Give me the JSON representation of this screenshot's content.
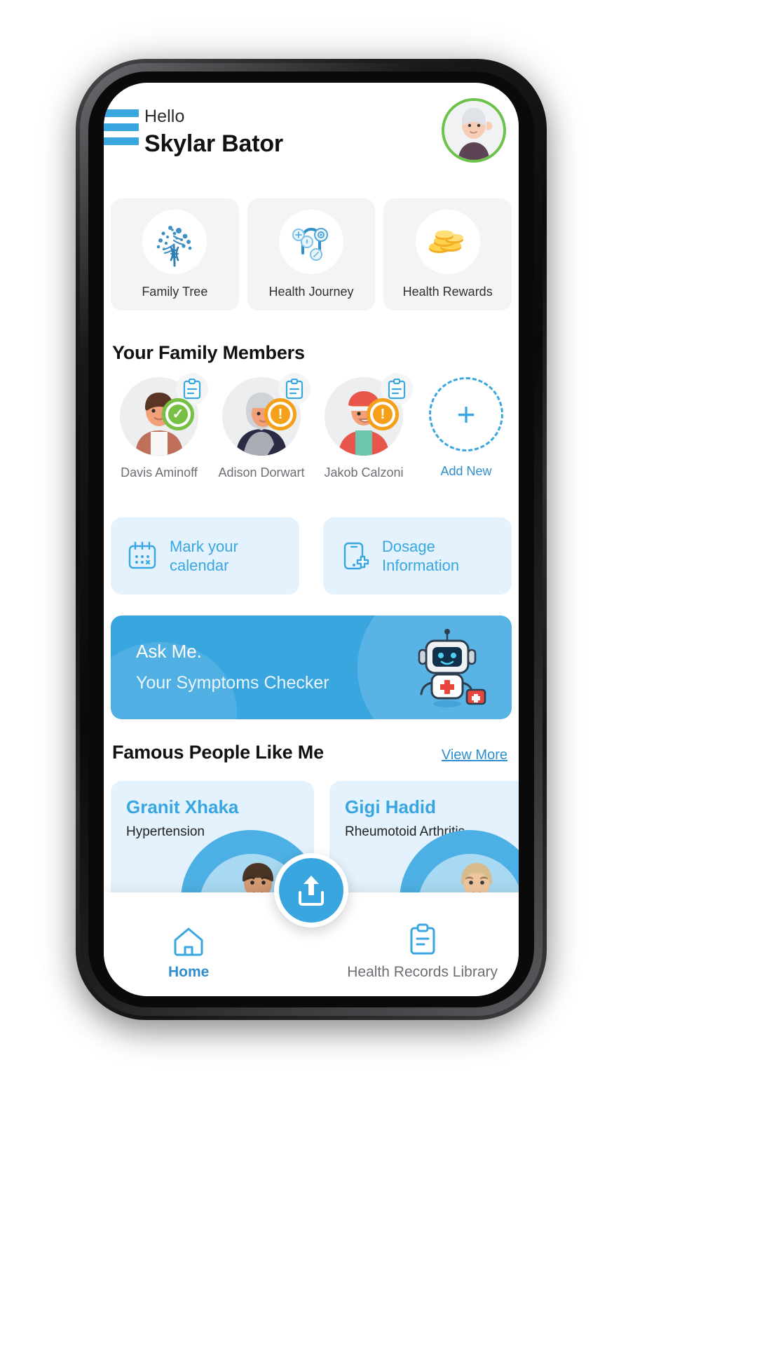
{
  "header": {
    "greeting": "Hello",
    "user_name": "Skylar Bator",
    "menu_icon": "hamburger-menu-icon",
    "avatar_icon": "user-avatar"
  },
  "quick_actions": [
    {
      "label": "Family Tree",
      "icon": "dna-tree-icon"
    },
    {
      "label": "Health Journey",
      "icon": "health-journey-path-icon"
    },
    {
      "label": "Health Rewards",
      "icon": "gold-coins-icon"
    }
  ],
  "family": {
    "section_title": "Your Family Members",
    "members": [
      {
        "name": "Davis Aminoff",
        "status": "ok",
        "status_icon": "check-badge-icon",
        "record_icon": "clipboard-icon"
      },
      {
        "name": "Adison Dorwart",
        "status": "warn",
        "status_icon": "warning-badge-icon",
        "record_icon": "clipboard-icon"
      },
      {
        "name": "Jakob Calzoni",
        "status": "warn",
        "status_icon": "warning-badge-icon",
        "record_icon": "clipboard-icon"
      }
    ],
    "add_new_label": "Add New",
    "add_new_icon": "plus-icon"
  },
  "actions": [
    {
      "line1": "Mark your",
      "line2": "calendar",
      "icon": "calendar-icon"
    },
    {
      "line1": "Dosage",
      "line2": "Information",
      "icon": "phone-pill-icon"
    }
  ],
  "banner": {
    "title": "Ask Me.",
    "subtitle": "Your Symptoms Checker",
    "icon": "robot-assistant-icon"
  },
  "famous": {
    "section_title": "Famous People Like Me",
    "view_more": "View More",
    "people": [
      {
        "name": "Granit Xhaka",
        "condition": "Hypertension"
      },
      {
        "name": "Gigi Hadid",
        "condition": "Rheumotoid Arthritis"
      }
    ]
  },
  "bottom_nav": {
    "items": [
      {
        "label": "Home",
        "icon": "home-icon",
        "active": true
      },
      {
        "label": "Health Records Library",
        "icon": "clipboard-icon",
        "active": false
      }
    ],
    "fab_icon": "upload-icon"
  },
  "colors": {
    "accent": "#3aa6e0",
    "accent_dark": "#2f8ecb",
    "soft_blue": "#e3f2fd",
    "card_grey": "#f3f4f6",
    "ok_green": "#77c043",
    "warn_orange": "#f6a01a",
    "text_dark": "#111111",
    "text_muted": "#6b6f74"
  }
}
